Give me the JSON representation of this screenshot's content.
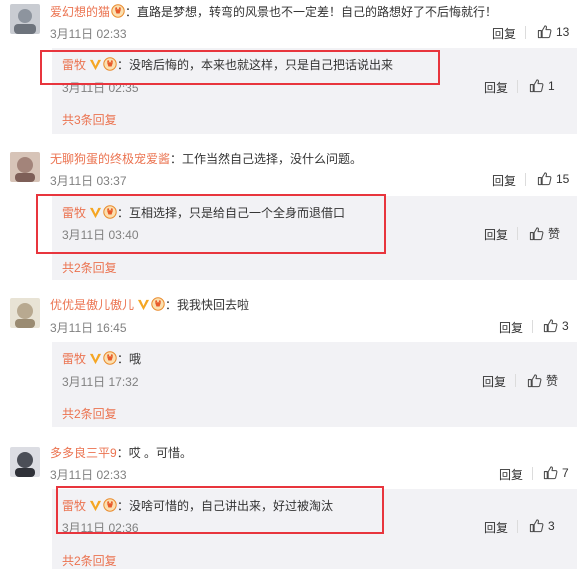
{
  "colors": {
    "username": "#eb7350",
    "more_link": "#eb7350",
    "sub_bg": "#f2f2f5",
    "highlight": "#e8353d"
  },
  "threads": [
    {
      "user": "爱幻想的猫",
      "text": "：直路是梦想，转弯的风景也不一定差！自己的路想好了不后悔就行！",
      "time": "3月11日 02:33",
      "reply_label": "回复",
      "likes": "13",
      "sub": {
        "user": "雷牧",
        "text": "：没啥后悔的，本来也就这样，只是自己把话说出来",
        "time": "3月11日 02:35",
        "reply_label": "回复",
        "likes": "1"
      },
      "more": "共3条回复"
    },
    {
      "user": "无聊狗蛋的终极宠爱酱",
      "text": "：工作当然自己选择，没什么问题。",
      "time": "3月11日 03:37",
      "reply_label": "回复",
      "likes": "15",
      "sub": {
        "user": "雷牧",
        "text": "：互相选择，只是给自己一个全身而退借口",
        "time": "3月11日 03:40",
        "reply_label": "回复",
        "likes": "赞"
      },
      "more": "共2条回复"
    },
    {
      "user": "优优是傲儿傲儿",
      "text": "：我我快回去啦",
      "time": "3月11日 16:45",
      "reply_label": "回复",
      "likes": "3",
      "sub": {
        "user": "雷牧",
        "text": "：哦",
        "time": "3月11日 17:32",
        "reply_label": "回复",
        "likes": "赞"
      },
      "more": "共2条回复"
    },
    {
      "user": "多多良三平9",
      "text": "：哎 。可惜。",
      "time": "3月11日 02:33",
      "reply_label": "回复",
      "likes": "7",
      "sub": {
        "user": "雷牧",
        "text": "：没啥可惜的，自己讲出来，好过被淘汰",
        "time": "3月11日 02:36",
        "reply_label": "回复",
        "likes": "3"
      },
      "more": "共2条回复"
    }
  ],
  "icons": {
    "verified": "verified-v-icon",
    "level_badge": "level-badge-icon",
    "like": "thumbs-up-icon"
  }
}
